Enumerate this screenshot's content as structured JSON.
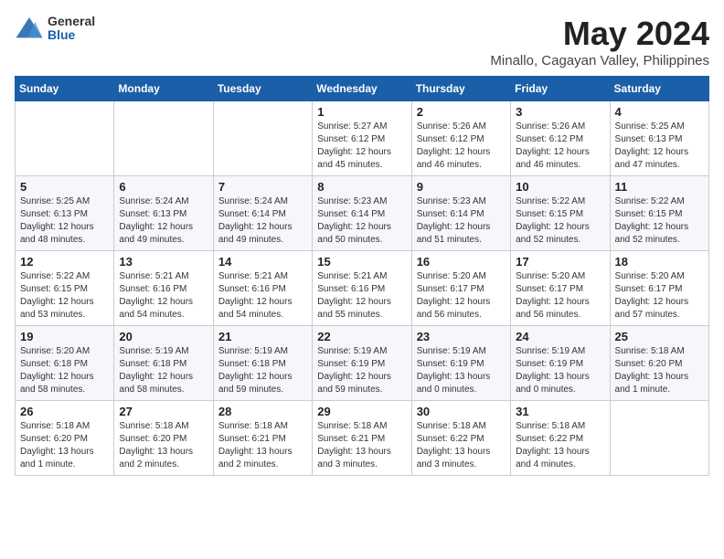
{
  "logo": {
    "general": "General",
    "blue": "Blue"
  },
  "title": {
    "month_year": "May 2024",
    "location": "Minallo, Cagayan Valley, Philippines"
  },
  "headers": [
    "Sunday",
    "Monday",
    "Tuesday",
    "Wednesday",
    "Thursday",
    "Friday",
    "Saturday"
  ],
  "weeks": [
    [
      {
        "day": "",
        "sunrise": "",
        "sunset": "",
        "daylight": ""
      },
      {
        "day": "",
        "sunrise": "",
        "sunset": "",
        "daylight": ""
      },
      {
        "day": "",
        "sunrise": "",
        "sunset": "",
        "daylight": ""
      },
      {
        "day": "1",
        "sunrise": "Sunrise: 5:27 AM",
        "sunset": "Sunset: 6:12 PM",
        "daylight": "Daylight: 12 hours and 45 minutes."
      },
      {
        "day": "2",
        "sunrise": "Sunrise: 5:26 AM",
        "sunset": "Sunset: 6:12 PM",
        "daylight": "Daylight: 12 hours and 46 minutes."
      },
      {
        "day": "3",
        "sunrise": "Sunrise: 5:26 AM",
        "sunset": "Sunset: 6:12 PM",
        "daylight": "Daylight: 12 hours and 46 minutes."
      },
      {
        "day": "4",
        "sunrise": "Sunrise: 5:25 AM",
        "sunset": "Sunset: 6:13 PM",
        "daylight": "Daylight: 12 hours and 47 minutes."
      }
    ],
    [
      {
        "day": "5",
        "sunrise": "Sunrise: 5:25 AM",
        "sunset": "Sunset: 6:13 PM",
        "daylight": "Daylight: 12 hours and 48 minutes."
      },
      {
        "day": "6",
        "sunrise": "Sunrise: 5:24 AM",
        "sunset": "Sunset: 6:13 PM",
        "daylight": "Daylight: 12 hours and 49 minutes."
      },
      {
        "day": "7",
        "sunrise": "Sunrise: 5:24 AM",
        "sunset": "Sunset: 6:14 PM",
        "daylight": "Daylight: 12 hours and 49 minutes."
      },
      {
        "day": "8",
        "sunrise": "Sunrise: 5:23 AM",
        "sunset": "Sunset: 6:14 PM",
        "daylight": "Daylight: 12 hours and 50 minutes."
      },
      {
        "day": "9",
        "sunrise": "Sunrise: 5:23 AM",
        "sunset": "Sunset: 6:14 PM",
        "daylight": "Daylight: 12 hours and 51 minutes."
      },
      {
        "day": "10",
        "sunrise": "Sunrise: 5:22 AM",
        "sunset": "Sunset: 6:15 PM",
        "daylight": "Daylight: 12 hours and 52 minutes."
      },
      {
        "day": "11",
        "sunrise": "Sunrise: 5:22 AM",
        "sunset": "Sunset: 6:15 PM",
        "daylight": "Daylight: 12 hours and 52 minutes."
      }
    ],
    [
      {
        "day": "12",
        "sunrise": "Sunrise: 5:22 AM",
        "sunset": "Sunset: 6:15 PM",
        "daylight": "Daylight: 12 hours and 53 minutes."
      },
      {
        "day": "13",
        "sunrise": "Sunrise: 5:21 AM",
        "sunset": "Sunset: 6:16 PM",
        "daylight": "Daylight: 12 hours and 54 minutes."
      },
      {
        "day": "14",
        "sunrise": "Sunrise: 5:21 AM",
        "sunset": "Sunset: 6:16 PM",
        "daylight": "Daylight: 12 hours and 54 minutes."
      },
      {
        "day": "15",
        "sunrise": "Sunrise: 5:21 AM",
        "sunset": "Sunset: 6:16 PM",
        "daylight": "Daylight: 12 hours and 55 minutes."
      },
      {
        "day": "16",
        "sunrise": "Sunrise: 5:20 AM",
        "sunset": "Sunset: 6:17 PM",
        "daylight": "Daylight: 12 hours and 56 minutes."
      },
      {
        "day": "17",
        "sunrise": "Sunrise: 5:20 AM",
        "sunset": "Sunset: 6:17 PM",
        "daylight": "Daylight: 12 hours and 56 minutes."
      },
      {
        "day": "18",
        "sunrise": "Sunrise: 5:20 AM",
        "sunset": "Sunset: 6:17 PM",
        "daylight": "Daylight: 12 hours and 57 minutes."
      }
    ],
    [
      {
        "day": "19",
        "sunrise": "Sunrise: 5:20 AM",
        "sunset": "Sunset: 6:18 PM",
        "daylight": "Daylight: 12 hours and 58 minutes."
      },
      {
        "day": "20",
        "sunrise": "Sunrise: 5:19 AM",
        "sunset": "Sunset: 6:18 PM",
        "daylight": "Daylight: 12 hours and 58 minutes."
      },
      {
        "day": "21",
        "sunrise": "Sunrise: 5:19 AM",
        "sunset": "Sunset: 6:18 PM",
        "daylight": "Daylight: 12 hours and 59 minutes."
      },
      {
        "day": "22",
        "sunrise": "Sunrise: 5:19 AM",
        "sunset": "Sunset: 6:19 PM",
        "daylight": "Daylight: 12 hours and 59 minutes."
      },
      {
        "day": "23",
        "sunrise": "Sunrise: 5:19 AM",
        "sunset": "Sunset: 6:19 PM",
        "daylight": "Daylight: 13 hours and 0 minutes."
      },
      {
        "day": "24",
        "sunrise": "Sunrise: 5:19 AM",
        "sunset": "Sunset: 6:19 PM",
        "daylight": "Daylight: 13 hours and 0 minutes."
      },
      {
        "day": "25",
        "sunrise": "Sunrise: 5:18 AM",
        "sunset": "Sunset: 6:20 PM",
        "daylight": "Daylight: 13 hours and 1 minute."
      }
    ],
    [
      {
        "day": "26",
        "sunrise": "Sunrise: 5:18 AM",
        "sunset": "Sunset: 6:20 PM",
        "daylight": "Daylight: 13 hours and 1 minute."
      },
      {
        "day": "27",
        "sunrise": "Sunrise: 5:18 AM",
        "sunset": "Sunset: 6:20 PM",
        "daylight": "Daylight: 13 hours and 2 minutes."
      },
      {
        "day": "28",
        "sunrise": "Sunrise: 5:18 AM",
        "sunset": "Sunset: 6:21 PM",
        "daylight": "Daylight: 13 hours and 2 minutes."
      },
      {
        "day": "29",
        "sunrise": "Sunrise: 5:18 AM",
        "sunset": "Sunset: 6:21 PM",
        "daylight": "Daylight: 13 hours and 3 minutes."
      },
      {
        "day": "30",
        "sunrise": "Sunrise: 5:18 AM",
        "sunset": "Sunset: 6:22 PM",
        "daylight": "Daylight: 13 hours and 3 minutes."
      },
      {
        "day": "31",
        "sunrise": "Sunrise: 5:18 AM",
        "sunset": "Sunset: 6:22 PM",
        "daylight": "Daylight: 13 hours and 4 minutes."
      },
      {
        "day": "",
        "sunrise": "",
        "sunset": "",
        "daylight": ""
      }
    ]
  ]
}
